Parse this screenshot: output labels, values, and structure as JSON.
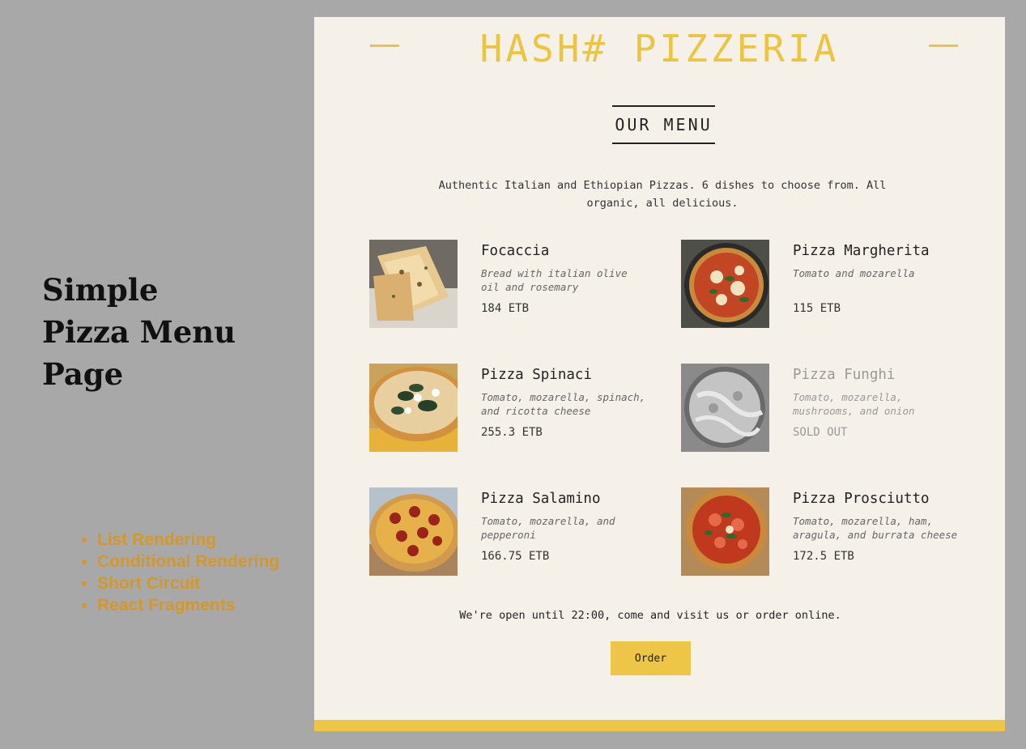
{
  "side": {
    "title_lines": [
      "Simple",
      "Pizza Menu",
      "Page"
    ],
    "features": [
      "List Rendering",
      "Conditional Rendering",
      "Short Circuit",
      "React Fragments"
    ]
  },
  "header": {
    "brand": "HASH# PIZZERIA"
  },
  "menu": {
    "heading": "OUR MENU",
    "intro": "Authentic Italian and Ethiopian Pizzas. 6 dishes to choose from. All organic, all delicious.",
    "pizzas": [
      {
        "name": "Focaccia",
        "description": "Bread with italian olive oil and rosemary",
        "price": "184 ETB",
        "sold_out": false
      },
      {
        "name": "Pizza Margherita",
        "description": "Tomato and mozarella",
        "price": "115 ETB",
        "sold_out": false
      },
      {
        "name": "Pizza Spinaci",
        "description": "Tomato, mozarella, spinach, and ricotta cheese",
        "price": "255.3 ETB",
        "sold_out": false
      },
      {
        "name": "Pizza Funghi",
        "description": "Tomato, mozarella, mushrooms, and onion",
        "price": "SOLD OUT",
        "sold_out": true
      },
      {
        "name": "Pizza Salamino",
        "description": "Tomato, mozarella, and pepperoni",
        "price": "166.75 ETB",
        "sold_out": false
      },
      {
        "name": "Pizza Prosciutto",
        "description": "Tomato, mozarella, ham, aragula, and burrata cheese",
        "price": "172.5 ETB",
        "sold_out": false
      }
    ]
  },
  "footer": {
    "text": "We're open until 22:00, come and visit us or order online.",
    "order_label": "Order"
  },
  "colors": {
    "accent": "#edc648",
    "background": "#a8a8a8",
    "card": "#f6f1e8",
    "feature": "#d4982a"
  }
}
